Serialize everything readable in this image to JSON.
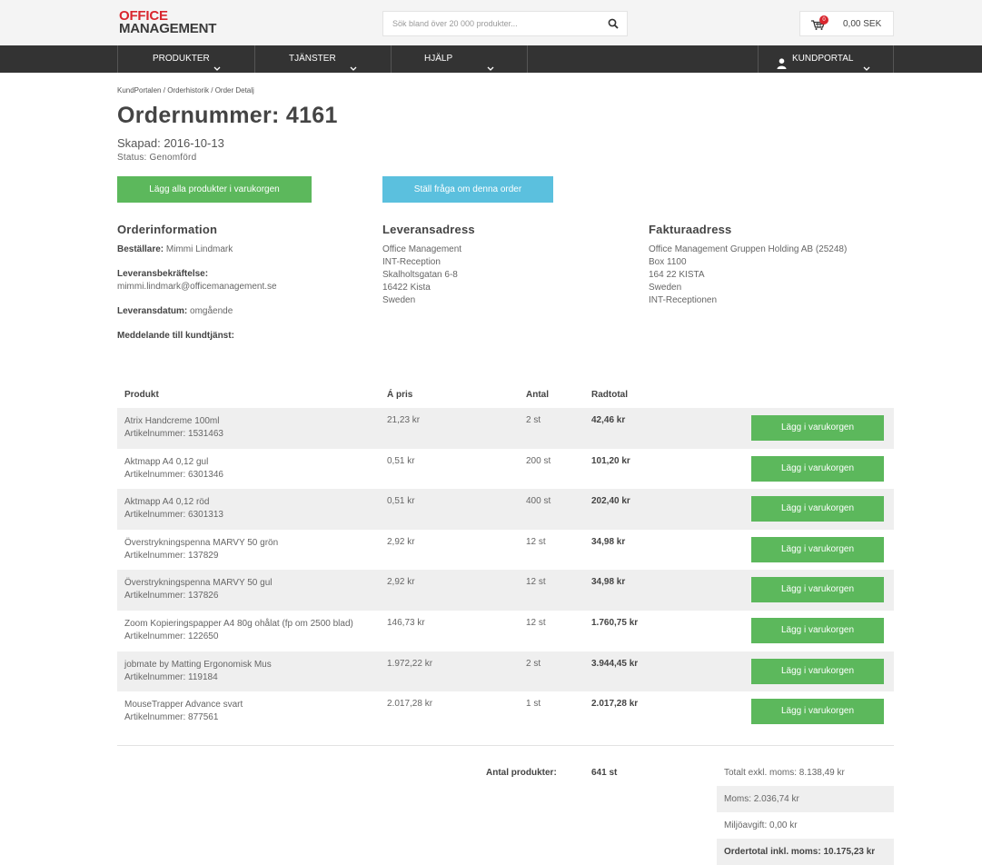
{
  "header": {
    "logo_line1": "OFFICE",
    "logo_line2": "MANAGEMENT",
    "search_placeholder": "Sök bland över 20 000 produkter...",
    "cart_count": "0",
    "cart_amount": "0,00 SEK"
  },
  "nav": {
    "items": [
      {
        "label": "PRODUKTER"
      },
      {
        "label": "TJÄNSTER"
      },
      {
        "label": "HJÄLP"
      },
      {
        "label": "KUNDPORTAL"
      }
    ]
  },
  "breadcrumb": {
    "part1": "KundPortalen",
    "sep1": "/",
    "part2": "Orderhistorik",
    "sep2": "/",
    "part3": "Order Detalj"
  },
  "order": {
    "title": "Ordernummer: 4161",
    "created": "Skapad: 2016-10-13",
    "status": "Status: Genomförd",
    "add_all_label": "Lägg alla produkter i varukorgen",
    "ask_label": "Ställ fråga om denna order"
  },
  "info": {
    "heading": "Orderinformation",
    "orderer_label": "Beställare:",
    "orderer_value": "Mimmi Lindmark",
    "confirmation_label": "Leveransbekräftelse:",
    "confirmation_value": "mimmi.lindmark@officemanagement.se",
    "delivery_date_label": "Leveransdatum:",
    "delivery_date_value": "omgående",
    "message_label": "Meddelande till kundtjänst:"
  },
  "delivery": {
    "heading": "Leveransadress",
    "lines": [
      "Office Management",
      "INT-Reception",
      "Skalholtsgatan 6-8",
      "16422 Kista",
      "Sweden"
    ]
  },
  "invoice": {
    "heading": "Fakturaadress",
    "lines": [
      "Office Management Gruppen Holding AB (25248)",
      "Box 1100",
      "164 22 KISTA",
      "Sweden",
      "INT-Receptionen"
    ]
  },
  "table": {
    "headers": {
      "product": "Produkt",
      "price": "Á pris",
      "qty": "Antal",
      "total": "Radtotal"
    },
    "rows": [
      {
        "name": "Atrix Handcreme 100ml",
        "article": "Artikelnummer: 1531463",
        "price": "21,23 kr",
        "qty": "2 st",
        "total": "42,46 kr",
        "button": "Lägg i varukorgen"
      },
      {
        "name": "Aktmapp A4 0,12 gul",
        "article": "Artikelnummer: 6301346",
        "price": "0,51 kr",
        "qty": "200 st",
        "total": "101,20 kr",
        "button": "Lägg i varukorgen"
      },
      {
        "name": "Aktmapp A4 0,12 röd",
        "article": "Artikelnummer: 6301313",
        "price": "0,51 kr",
        "qty": "400 st",
        "total": "202,40 kr",
        "button": "Lägg i varukorgen"
      },
      {
        "name": "Överstrykningspenna MARVY 50 grön",
        "article": "Artikelnummer: 137829",
        "price": "2,92 kr",
        "qty": "12 st",
        "total": "34,98 kr",
        "button": "Lägg i varukorgen"
      },
      {
        "name": "Överstrykningspenna MARVY 50 gul",
        "article": "Artikelnummer: 137826",
        "price": "2,92 kr",
        "qty": "12 st",
        "total": "34,98 kr",
        "button": "Lägg i varukorgen"
      },
      {
        "name": "Zoom Kopieringspapper A4 80g ohålat (fp om 2500 blad)",
        "article": "Artikelnummer: 122650",
        "price": "146,73 kr",
        "qty": "12 st",
        "total": "1.760,75 kr",
        "button": "Lägg i varukorgen"
      },
      {
        "name": "jobmate by Matting Ergonomisk Mus",
        "article": "Artikelnummer: 119184",
        "price": "1.972,22 kr",
        "qty": "2 st",
        "total": "3.944,45 kr",
        "button": "Lägg i varukorgen"
      },
      {
        "name": "MouseTrapper Advance svart",
        "article": "Artikelnummer: 877561",
        "price": "2.017,28 kr",
        "qty": "1 st",
        "total": "2.017,28 kr",
        "button": "Lägg i varukorgen"
      }
    ]
  },
  "summary": {
    "count_label": "Antal produkter:",
    "count_value": "641 st",
    "excl_vat": "Totalt exkl. moms: 8.138,49 kr",
    "vat": "Moms: 2.036,74 kr",
    "env_fee": "Miljöavgift: 0,00 kr",
    "total_incl": "Ordertotal inkl. moms: 10.175,23 kr"
  },
  "colors": {
    "brand_red": "#d9262e",
    "nav_bg": "#333333",
    "button_green": "#5cb85c",
    "button_blue": "#5bc0de"
  },
  "icons": {
    "search": "search-icon",
    "cart": "cart-icon",
    "user": "user-icon",
    "chevron": "chevron-down-icon"
  }
}
